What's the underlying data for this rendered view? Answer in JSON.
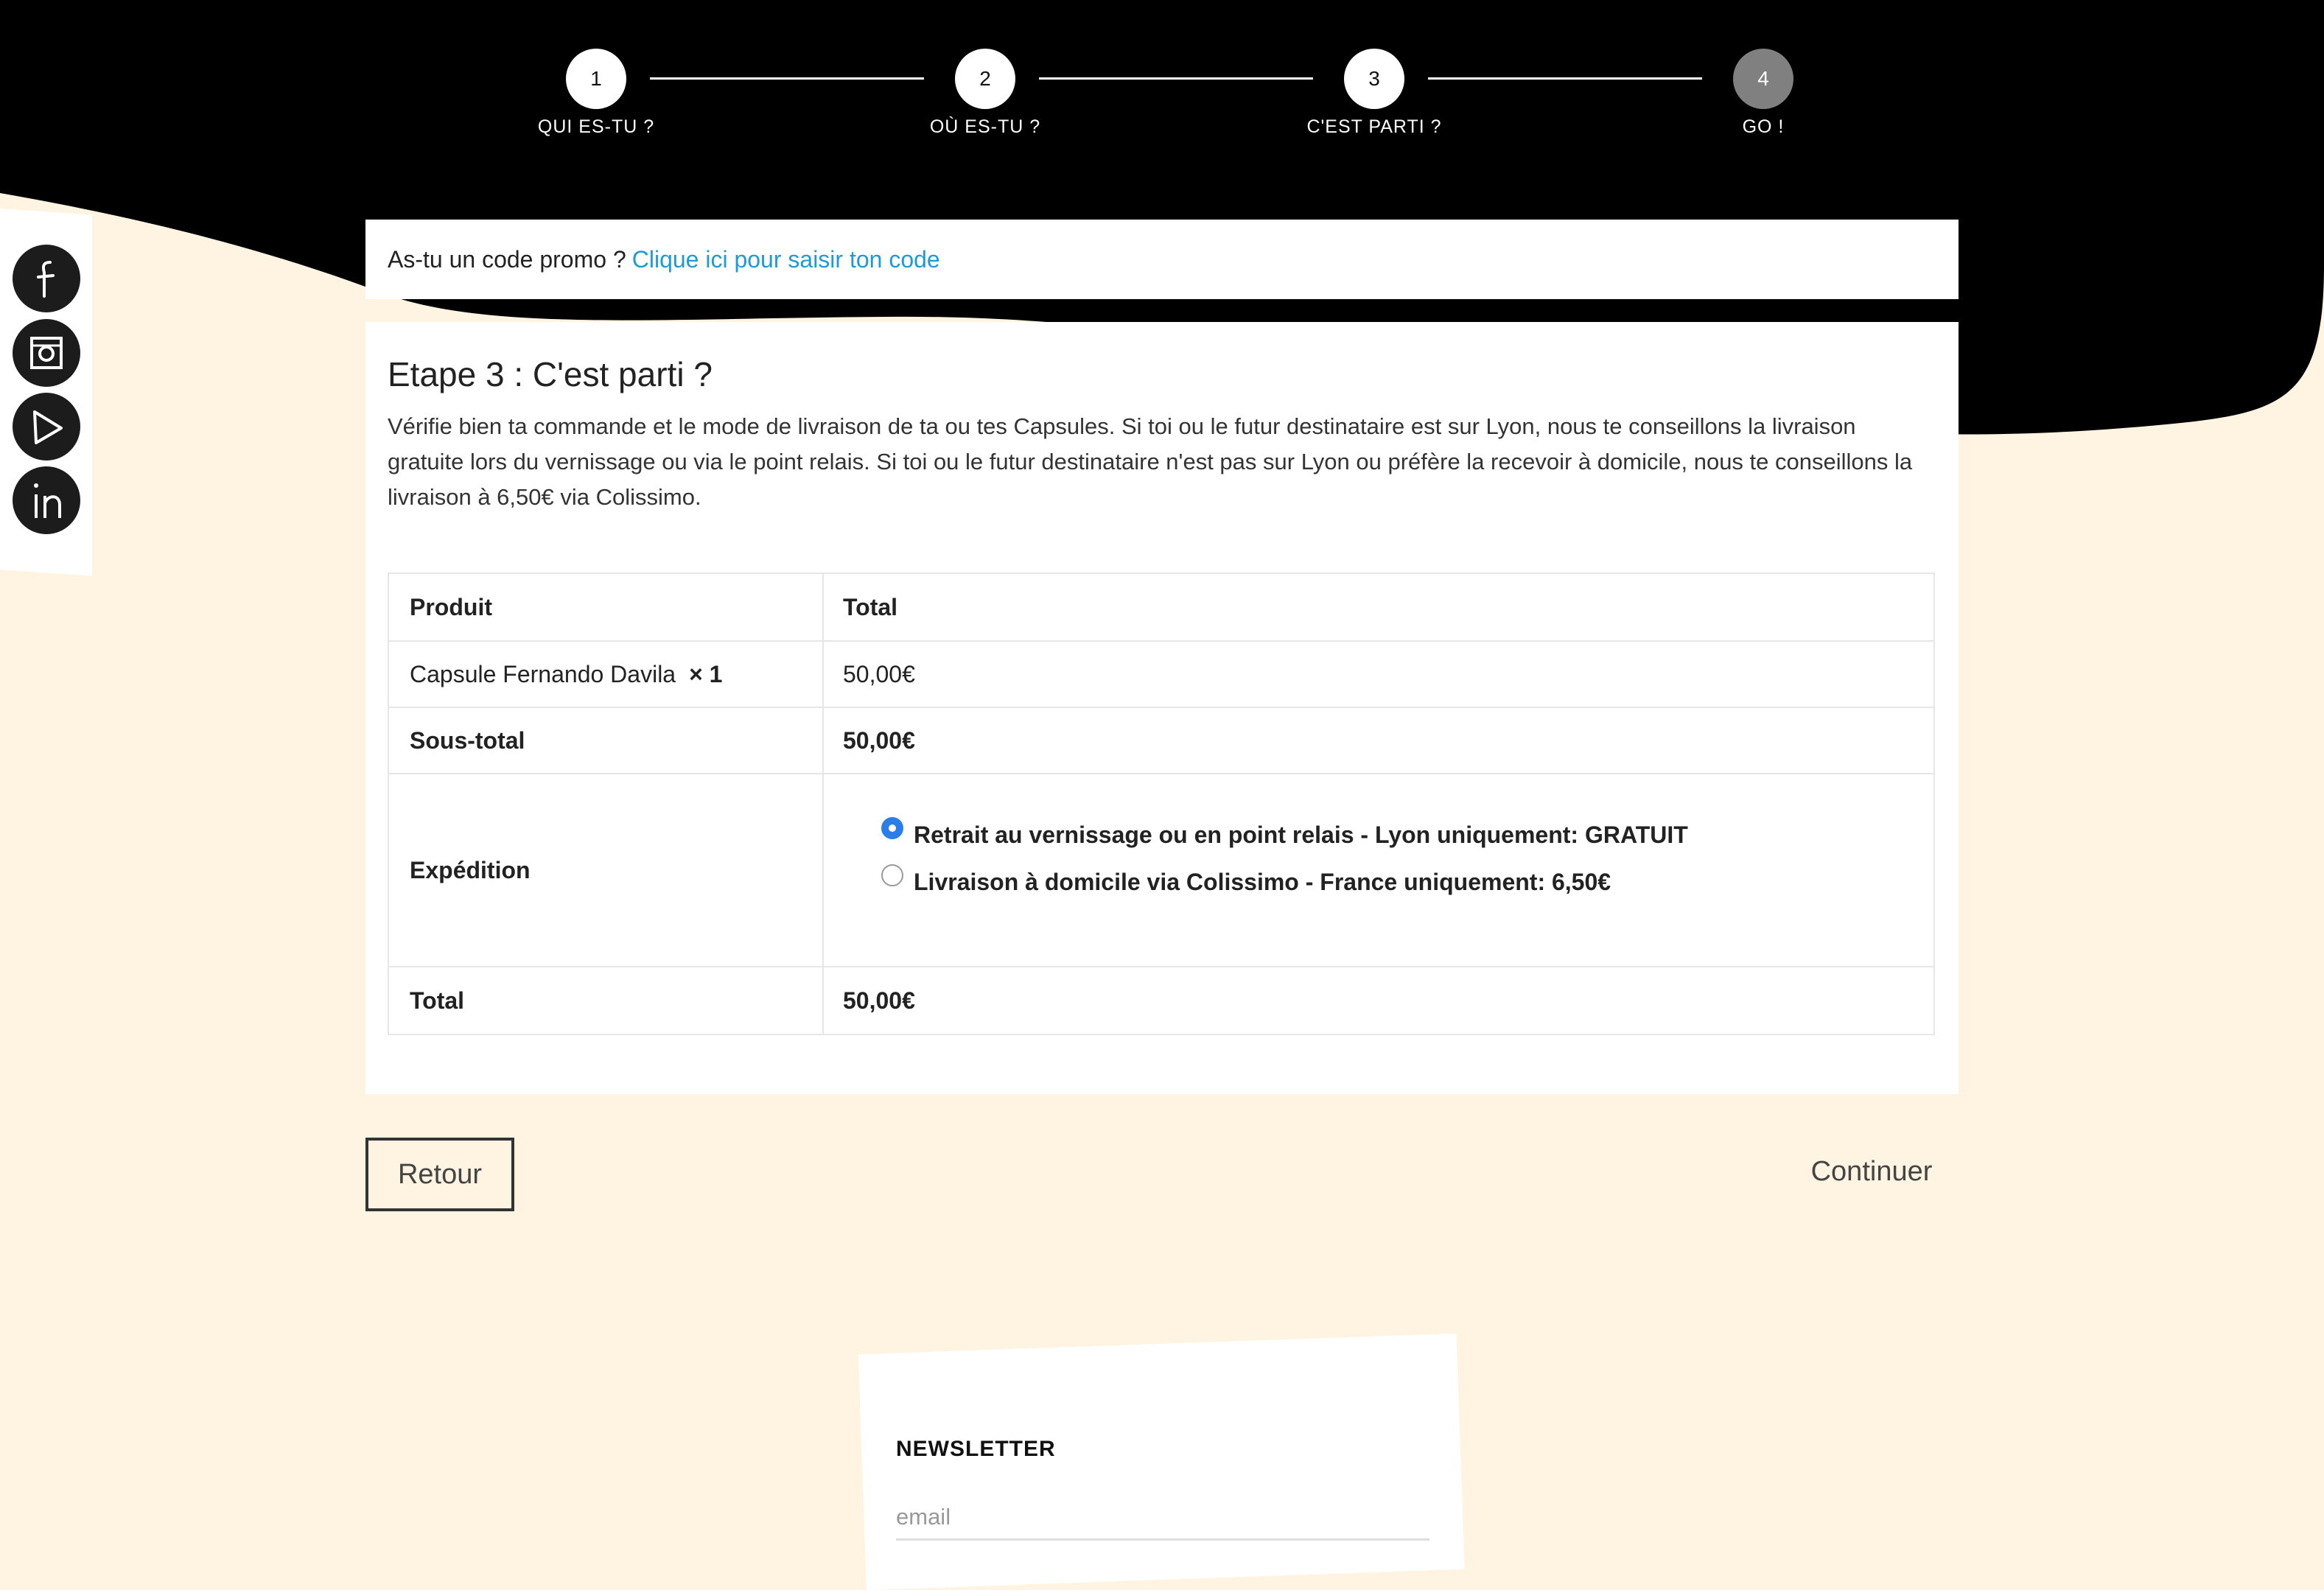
{
  "stepper": {
    "steps": [
      {
        "number": "1",
        "label": "QUI ES-TU ?"
      },
      {
        "number": "2",
        "label": "OÙ ES-TU ?"
      },
      {
        "number": "3",
        "label": "C'EST PARTI ?"
      },
      {
        "number": "4",
        "label": "GO !"
      }
    ]
  },
  "social": {
    "icons": [
      "facebook-icon",
      "instagram-icon",
      "play-icon",
      "linkedin-icon"
    ]
  },
  "promo": {
    "text": "As-tu un code promo ?",
    "link": "Clique ici pour saisir ton code"
  },
  "main": {
    "title": "Etape 3 : C'est parti ?",
    "description": "Vérifie bien ta commande et le mode de livraison de ta ou tes Capsules. Si toi ou le futur destinataire est sur Lyon, nous te conseillons la livraison gratuite lors du vernissage ou via le point relais. Si toi ou le futur destinataire n'est pas sur Lyon ou préfère la recevoir à domicile, nous te conseillons la livraison à 6,50€ via Colissimo."
  },
  "table": {
    "headers": {
      "product": "Produit",
      "total": "Total"
    },
    "item": {
      "name": "Capsule Fernando Davila",
      "qty": "× 1",
      "total": "50,00€"
    },
    "subtotal": {
      "label": "Sous-total",
      "value": "50,00€"
    },
    "shipping": {
      "label": "Expédition",
      "options": [
        {
          "label": "Retrait au vernissage ou en point relais - Lyon uniquement: GRATUIT",
          "selected": true
        },
        {
          "label": "Livraison à domicile via Colissimo - France uniquement: 6,50€",
          "selected": false
        }
      ]
    },
    "total": {
      "label": "Total",
      "value": "50,00€"
    }
  },
  "buttons": {
    "back": "Retour",
    "continue": "Continuer"
  },
  "newsletter": {
    "title": "NEWSLETTER",
    "placeholder": "email"
  },
  "colors": {
    "background": "#fff4e2",
    "dark": "#000000",
    "link": "#1e9bd7",
    "radio": "#2b7de9",
    "active_step": "#808080"
  }
}
